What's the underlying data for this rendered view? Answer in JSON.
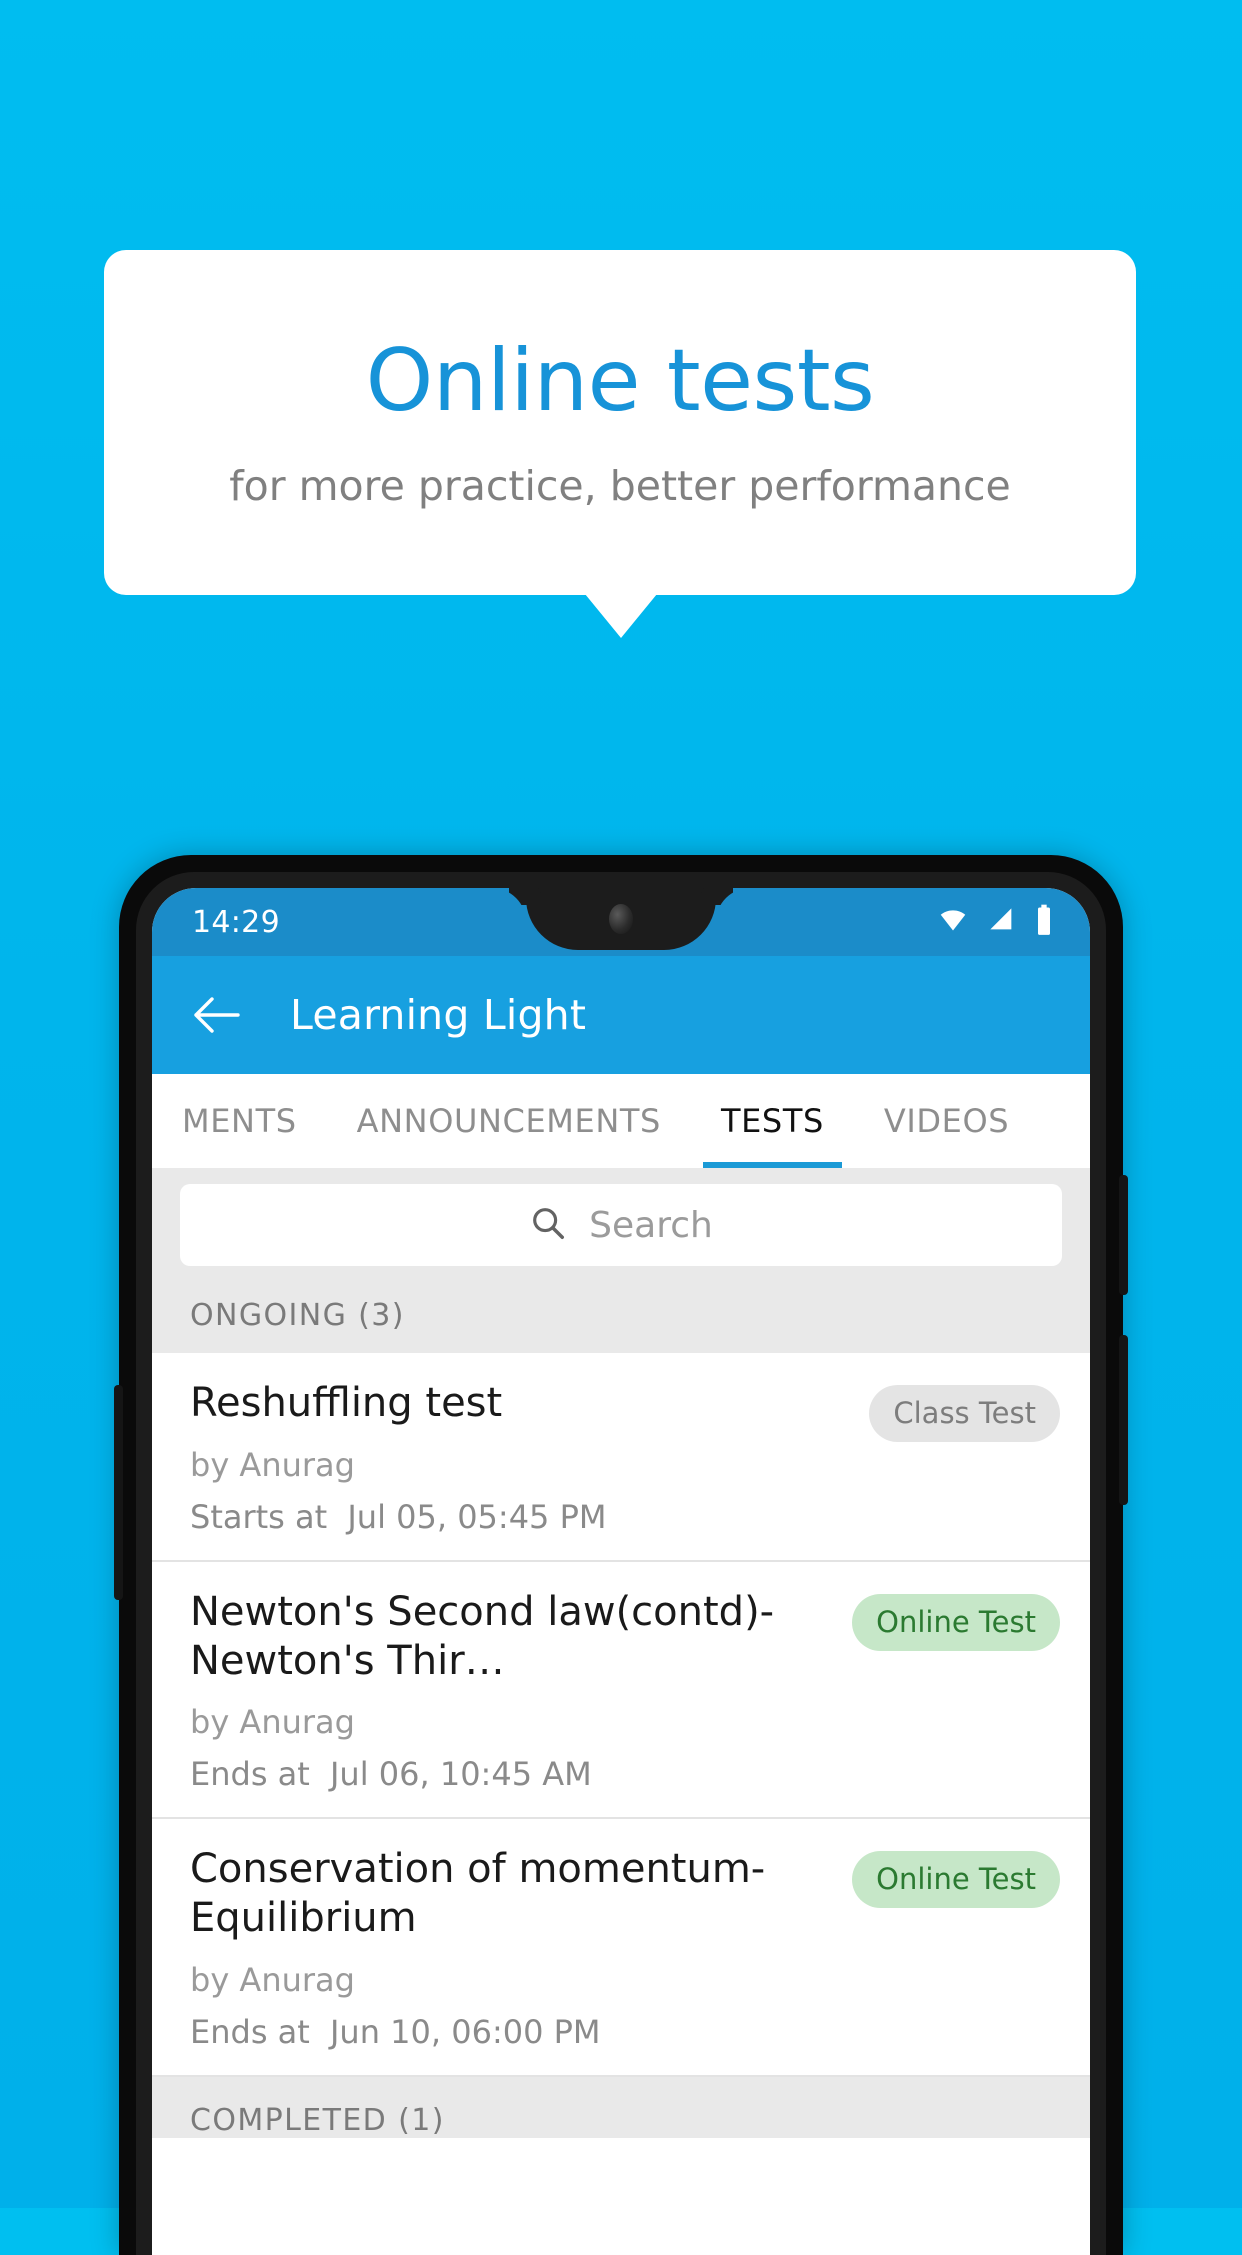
{
  "promo": {
    "title": "Online tests",
    "subtitle": "for more practice, better performance"
  },
  "colors": {
    "background": "#00bff0",
    "promo_title": "#1793d8",
    "appbar": "#17a0e0",
    "statusbar": "#1b8cc9",
    "tab_active_underline": "#1b9ad6",
    "badge_gray_bg": "#e4e4e4",
    "badge_gray_text": "#7d7d7d",
    "badge_green_bg": "#c6e7c8",
    "badge_green_text": "#2b7a31"
  },
  "statusbar": {
    "time": "14:29",
    "icons": [
      "wifi-icon",
      "signal-icon",
      "battery-icon"
    ]
  },
  "appbar": {
    "back_icon": "back-arrow-icon",
    "title": "Learning Light"
  },
  "tabs": [
    {
      "label": "MENTS",
      "active": false
    },
    {
      "label": "ANNOUNCEMENTS",
      "active": false
    },
    {
      "label": "TESTS",
      "active": true
    },
    {
      "label": "VIDEOS",
      "active": false
    }
  ],
  "search": {
    "icon": "search-icon",
    "placeholder": "Search",
    "value": ""
  },
  "sections": {
    "ongoing_header": "ONGOING (3)",
    "completed_header": "COMPLETED (1)"
  },
  "tests": [
    {
      "title": "Reshuffling test",
      "author": "by Anurag",
      "when_label": "Starts at",
      "when_value": "Jul 05, 05:45 PM",
      "badge": "Class Test",
      "badge_type": "gray"
    },
    {
      "title": "Newton's Second law(contd)-Newton's Thir…",
      "author": "by Anurag",
      "when_label": "Ends at",
      "when_value": "Jul 06, 10:45 AM",
      "badge": "Online Test",
      "badge_type": "green"
    },
    {
      "title": "Conservation of momentum-Equilibrium",
      "author": "by Anurag",
      "when_label": "Ends at",
      "when_value": "Jun 10, 06:00 PM",
      "badge": "Online Test",
      "badge_type": "green"
    }
  ]
}
